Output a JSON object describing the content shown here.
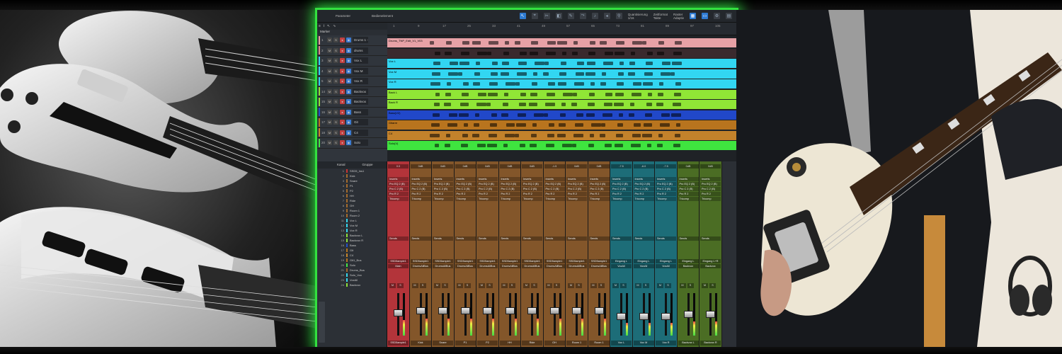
{
  "toolbar": {
    "parameter_label": "Parameter",
    "bedienelement_label": "Bedienelement",
    "quantize_label": "Quantisierung",
    "quantize_value": "1/16",
    "timebase_label": "Zeitformat",
    "timebase_value": "Takte",
    "snap_label": "Raster",
    "snap_value": "Adaptiv"
  },
  "arrangement": {
    "marker_label": "Marker",
    "ruler_ticks": [
      "1",
      "9",
      "17",
      "25",
      "33",
      "41",
      "49",
      "57",
      "65",
      "73",
      "81",
      "89",
      "97",
      "105"
    ],
    "tracks": [
      {
        "num": "1",
        "name": "Drums 1 - V03",
        "color": "#e8a0a0"
      },
      {
        "num": "2",
        "name": "drums",
        "color": "#d98b8b"
      },
      {
        "num": "3",
        "name": "Vox L",
        "color": "#35d8f0"
      },
      {
        "num": "4",
        "name": "Vox M",
        "color": "#35d8f0"
      },
      {
        "num": "5",
        "name": "Vox R",
        "color": "#35d8f0"
      },
      {
        "num": "14",
        "name": "Backvox L",
        "color": "#8ee23a"
      },
      {
        "num": "15",
        "name": "Backvox R",
        "color": "#8ee23a"
      },
      {
        "num": "16",
        "name": "Bass",
        "color": "#2450c8"
      },
      {
        "num": "17",
        "name": "Git",
        "color": "#b8761f"
      },
      {
        "num": "18",
        "name": "C4",
        "color": "#c9862a"
      },
      {
        "num": "20",
        "name": "Solo",
        "color": "#46e846"
      }
    ],
    "clips": [
      {
        "label": "Drums_TNP_Edit_V1_V03",
        "color": "#e7a1a6"
      },
      {
        "label": "",
        "color": "#3a2a2e"
      },
      {
        "label": "Vox L",
        "color": "#32d6f2"
      },
      {
        "label": "Vox M",
        "color": "#32d6f2"
      },
      {
        "label": "Vox R",
        "color": "#32d6f2"
      },
      {
        "label": "Back L",
        "color": "#90e636"
      },
      {
        "label": "Back R",
        "color": "#90e636"
      },
      {
        "label": "Bass(V2)",
        "color": "#2148c9"
      },
      {
        "label": "Gitarre",
        "color": "#b8741e"
      },
      {
        "label": "C4",
        "color": "#c3822b"
      },
      {
        "label": "Solo(V)",
        "color": "#3fe43f"
      }
    ]
  },
  "mixer": {
    "list_header": [
      "Kanal",
      "Gruppe"
    ],
    "channels": [
      {
        "n": "1",
        "name": "SSD5_Ins1",
        "c": "#c33"
      },
      {
        "n": "2",
        "name": "Kick",
        "c": "#a66b2b"
      },
      {
        "n": "3",
        "name": "Snare",
        "c": "#a66b2b"
      },
      {
        "n": "4",
        "name": "P1",
        "c": "#a66b2b"
      },
      {
        "n": "5",
        "name": "P2",
        "c": "#a66b2b"
      },
      {
        "n": "6",
        "name": "HH",
        "c": "#a66b2b"
      },
      {
        "n": "7",
        "name": "Ride",
        "c": "#a66b2b"
      },
      {
        "n": "8",
        "name": "OH",
        "c": "#a66b2b"
      },
      {
        "n": "9",
        "name": "Room 1",
        "c": "#a66b2b"
      },
      {
        "n": "10",
        "name": "Room 2",
        "c": "#a66b2b"
      },
      {
        "n": "11",
        "name": "Vox L",
        "c": "#35d8f0"
      },
      {
        "n": "12",
        "name": "Vox M",
        "c": "#35d8f0"
      },
      {
        "n": "13",
        "name": "Vox R",
        "c": "#35d8f0"
      },
      {
        "n": "14",
        "name": "Backvox L",
        "c": "#8ee23a"
      },
      {
        "n": "15",
        "name": "Backvox R",
        "c": "#8ee23a"
      },
      {
        "n": "16",
        "name": "Bass",
        "c": "#2450c8"
      },
      {
        "n": "17",
        "name": "Git",
        "c": "#b8761f"
      },
      {
        "n": "18",
        "name": "C4",
        "c": "#c9862a"
      },
      {
        "n": "19",
        "name": "Git1_Bus",
        "c": "#b8761f"
      },
      {
        "n": "20",
        "name": "Solo",
        "c": "#46e846"
      },
      {
        "n": "21",
        "name": "Drums_Bus",
        "c": "#a66b2b"
      },
      {
        "n": "22",
        "name": "Solo_Vox",
        "c": "#35d8f0"
      },
      {
        "n": "23",
        "name": "VoxAll",
        "c": "#35d8f0"
      },
      {
        "n": "24",
        "name": "Backvox",
        "c": "#8ee23a"
      }
    ],
    "strips": [
      {
        "name": "SSD5ample1",
        "io_in": "SSD5ample1",
        "io_out": "Main",
        "color": "#b3343a",
        "vol": "0.0",
        "fader": 0.55
      },
      {
        "name": "Kick",
        "io_in": "SSD5ample1",
        "io_out": "DrumsAllBus",
        "color": "#83562a",
        "vol": "0dB",
        "fader": 0.6
      },
      {
        "name": "Snare",
        "io_in": "SSD5ample1",
        "io_out": "DrumsAllBus",
        "color": "#83562a",
        "vol": "0dB",
        "fader": 0.6
      },
      {
        "name": "P1",
        "io_in": "SSD5ample1",
        "io_out": "DrumsAllBus",
        "color": "#83562a",
        "vol": "0dB",
        "fader": 0.6
      },
      {
        "name": "P2",
        "io_in": "SSD5ample1",
        "io_out": "DrumsAllBus",
        "color": "#83562a",
        "vol": "0dB",
        "fader": 0.6
      },
      {
        "name": "HH",
        "io_in": "SSD5ample1",
        "io_out": "DrumsAllBus",
        "color": "#83562a",
        "vol": "0dB",
        "fader": 0.6
      },
      {
        "name": "Ride",
        "io_in": "SSD5ample1",
        "io_out": "DrumsAllBus",
        "color": "#83562a",
        "vol": "0dB",
        "fader": 0.6
      },
      {
        "name": "OH",
        "io_in": "SSD5ample1",
        "io_out": "DrumsAllBus",
        "color": "#83562a",
        "vol": "-1.5",
        "fader": 0.6
      },
      {
        "name": "Room 1",
        "io_in": "SSD5ample1",
        "io_out": "DrumsAllBus",
        "color": "#83562a",
        "vol": "0dB",
        "fader": 0.6
      },
      {
        "name": "Room 1",
        "io_in": "SSD5ample1",
        "io_out": "DrumsAllBus",
        "color": "#83562a",
        "vol": "0dB",
        "fader": 0.6
      },
      {
        "name": "Vox L",
        "io_in": "Eingang L",
        "io_out": "VoxAll",
        "color": "#1d6d78",
        "vol": "-7.5",
        "fader": 0.45
      },
      {
        "name": "Vox M",
        "io_in": "Eingang L",
        "io_out": "VoxAll",
        "color": "#1d6d78",
        "vol": "-6.0",
        "fader": 0.45
      },
      {
        "name": "Vox R",
        "io_in": "Eingang L",
        "io_out": "VoxAll",
        "color": "#1d6d78",
        "vol": "-7.5",
        "fader": 0.45
      },
      {
        "name": "Backvox L",
        "io_in": "Eingang L",
        "io_out": "Backvox",
        "color": "#4b6d24",
        "vol": "0dB",
        "fader": 0.5
      },
      {
        "name": "Backvox R",
        "io_in": "Eingang L+R",
        "io_out": "Backvox",
        "color": "#4b6d24",
        "vol": "0dB",
        "fader": 0.5
      }
    ],
    "insert_label": "Inserts",
    "insert_items": [
      "Pro EQ 2 (B)",
      "Pro C 2 (B)",
      "Pro R 2",
      "Tricomp"
    ],
    "sends_label": "Sends",
    "mute_label": "M",
    "solo_label": "S"
  }
}
